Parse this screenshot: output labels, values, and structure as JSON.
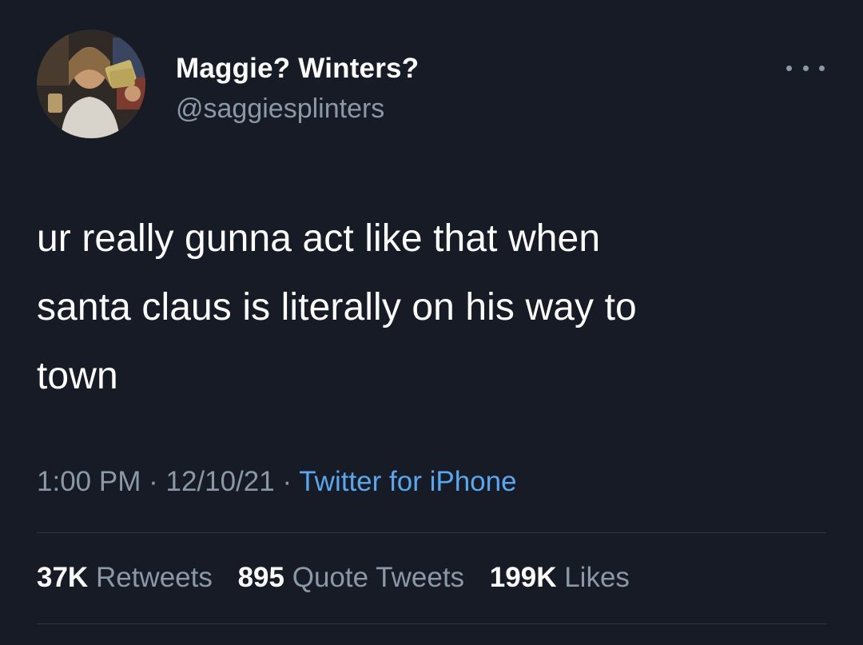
{
  "author": {
    "display_name": "Maggie? Winters?",
    "handle": "@saggiesplinters"
  },
  "tweet": {
    "lines": [
      "ur really gunna act like that when",
      "santa claus is literally on his way to",
      "town"
    ]
  },
  "meta": {
    "time": "1:00 PM",
    "separator": "·",
    "date": "12/10/21",
    "source": "Twitter for iPhone"
  },
  "stats": {
    "retweets_count": "37K",
    "retweets_label": "Retweets",
    "quotes_count": "895",
    "quotes_label": "Quote Tweets",
    "likes_count": "199K",
    "likes_label": "Likes"
  },
  "colors": {
    "background": "#161b26",
    "secondary_text": "#8b98a5",
    "link": "#5aa7ee"
  },
  "icons": {
    "more": "more-horizontal-icon"
  }
}
